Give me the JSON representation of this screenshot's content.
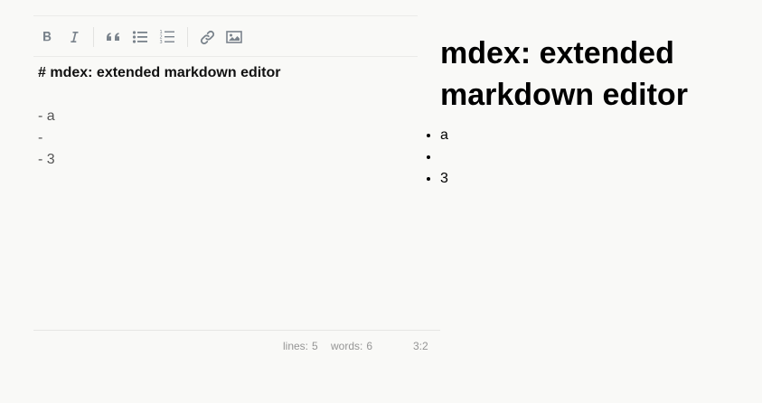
{
  "toolbar": {
    "buttons": [
      {
        "icon": "bold-icon"
      },
      {
        "icon": "italic-icon"
      },
      {
        "icon": "quote-icon"
      },
      {
        "icon": "unordered-list-icon"
      },
      {
        "icon": "ordered-list-icon"
      },
      {
        "icon": "link-icon"
      },
      {
        "icon": "image-icon"
      }
    ],
    "icon_color": "#7a838c"
  },
  "editor": {
    "lines": [
      "# mdex: extended markdown editor",
      "",
      "- a",
      "-",
      "- 3"
    ]
  },
  "statusbar": {
    "lines_label": "lines:",
    "lines_value": "5",
    "words_label": "words:",
    "words_value": "6",
    "cursor": "3:2"
  },
  "preview": {
    "heading": "mdex: extended markdown editor",
    "list_items": [
      "a",
      "",
      "3"
    ]
  },
  "colors": {
    "background": "#f9f9f7",
    "heading_text": "#111111",
    "body_text": "#555555",
    "status_text": "#959595"
  }
}
